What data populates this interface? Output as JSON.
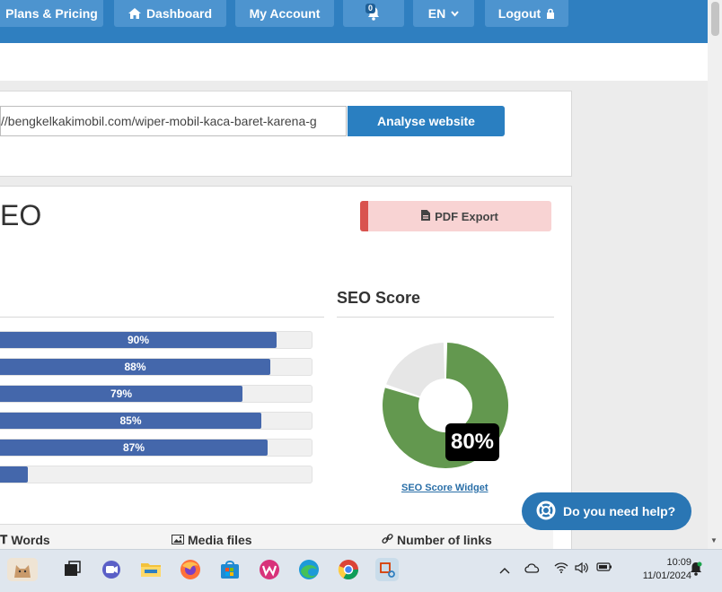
{
  "nav": {
    "plans": "Plans & Pricing",
    "dashboard": "Dashboard",
    "account": "My Account",
    "notifications_count": "0",
    "language": "EN",
    "logout": "Logout"
  },
  "analyse": {
    "url_value": "//bengkelkakimobil.com/wiper-mobil-kaca-baret-karena-g",
    "button": "Analyse website"
  },
  "report": {
    "title_fragment": "EO",
    "pdf_button": "PDF Export"
  },
  "bars": [
    {
      "label": "90%",
      "value": 90
    },
    {
      "label": "88%",
      "value": 88
    },
    {
      "label": "79%",
      "value": 79
    },
    {
      "label": "85%",
      "value": 85
    },
    {
      "label": "87%",
      "value": 87
    },
    {
      "label": "",
      "value": 9
    }
  ],
  "seo_score": {
    "heading": "SEO Score",
    "value_label": "80%",
    "value": 80,
    "widget_link": "SEO Score Widget",
    "colors": {
      "filled": "#63984f",
      "empty": "#e6e6e6"
    }
  },
  "stats": {
    "words": "Words",
    "media": "Media files",
    "links": "Number of links"
  },
  "help": {
    "label": "Do you need help?"
  },
  "taskbar": {
    "time": "10:09",
    "date": "11/01/2024"
  },
  "colors": {
    "nav": "#2f7fc0",
    "accent": "#2a7fc1",
    "bar": "#4467ab",
    "pdf": "#d9534f"
  }
}
